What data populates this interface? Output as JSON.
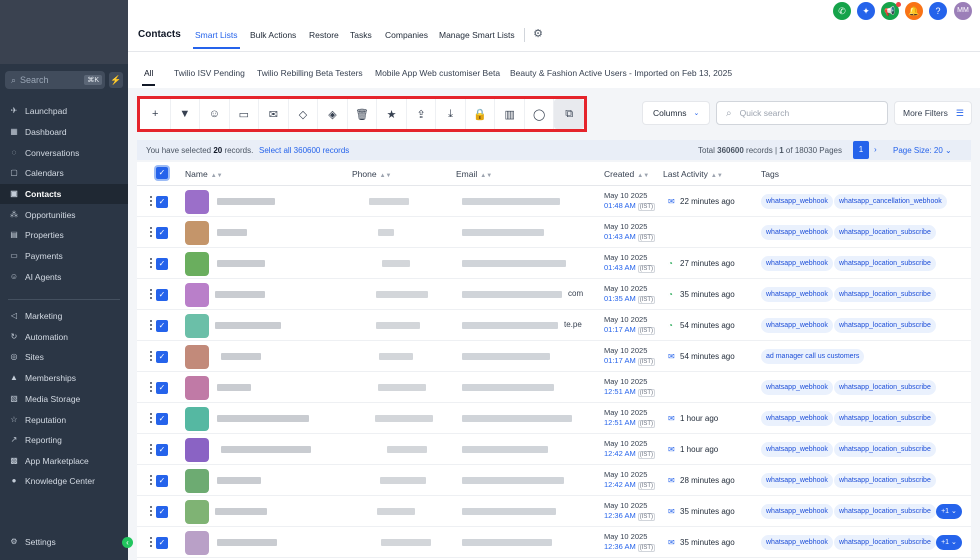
{
  "sidebar": {
    "search_placeholder": "Search",
    "search_shortcut": "⌘K",
    "items": [
      {
        "label": "Launchpad",
        "icon": "rocket-icon"
      },
      {
        "label": "Dashboard",
        "icon": "grid-icon"
      },
      {
        "label": "Conversations",
        "icon": "chat-icon"
      },
      {
        "label": "Calendars",
        "icon": "calendar-icon"
      },
      {
        "label": "Contacts",
        "icon": "person-icon"
      },
      {
        "label": "Opportunities",
        "icon": "nodes-icon"
      },
      {
        "label": "Properties",
        "icon": "building-icon"
      },
      {
        "label": "Payments",
        "icon": "card-icon"
      },
      {
        "label": "AI Agents",
        "icon": "robot-icon"
      },
      {
        "label": "Marketing",
        "icon": "megaphone-icon"
      },
      {
        "label": "Automation",
        "icon": "refresh-icon"
      },
      {
        "label": "Sites",
        "icon": "globe-icon"
      },
      {
        "label": "Memberships",
        "icon": "graduation-icon"
      },
      {
        "label": "Media Storage",
        "icon": "media-icon"
      },
      {
        "label": "Reputation",
        "icon": "star-icon"
      },
      {
        "label": "Reporting",
        "icon": "chart-icon"
      },
      {
        "label": "App Marketplace",
        "icon": "apps-icon"
      },
      {
        "label": "Knowledge Center",
        "icon": "info-icon"
      },
      {
        "label": "Settings",
        "icon": "gear-icon"
      }
    ]
  },
  "header": {
    "title": "Contacts",
    "tabs": [
      "Smart Lists",
      "Bulk Actions",
      "Restore",
      "Tasks",
      "Companies",
      "Manage Smart Lists"
    ],
    "avatar_initials": "MM"
  },
  "smart_lists": [
    "All",
    "Twilio ISV Pending",
    "Twilio Rebilling Beta Testers",
    "Mobile App Web customiser Beta",
    "Beauty & Fashion Active Users - Imported on Feb 13, 2025"
  ],
  "toolbar": {
    "icons": [
      "add-icon",
      "filter-icon",
      "robot-icon",
      "message-icon",
      "email-icon",
      "tag-add-icon",
      "tag-remove-icon",
      "trash-icon",
      "star-icon",
      "upload-icon",
      "download-icon",
      "lock-icon",
      "building-icon",
      "whatsapp-icon",
      "copy-icon"
    ],
    "columns_label": "Columns",
    "search_placeholder": "Quick search",
    "more_filters_label": "More Filters"
  },
  "selection": {
    "prefix": "You have selected ",
    "count": "20",
    "suffix": " records.",
    "select_all": "Select all 360600 records",
    "total_prefix": "Total ",
    "total": "360600",
    "total_mid": " records | ",
    "page": "1",
    "page_suffix": " of 18030 Pages",
    "page_button": "1",
    "page_size": "Page Size: 20"
  },
  "table": {
    "columns": [
      "Name",
      "Phone",
      "Email",
      "Created",
      "Last Activity",
      "Tags"
    ],
    "rows": [
      {
        "date": "May 10 2025",
        "time": "01:48 AM",
        "tz": "(IST)",
        "activity": "22 minutes ago",
        "activity_icon": "email-icon",
        "tags": [
          "whatsapp_webhook",
          "whatsapp_cancellation_webhook"
        ],
        "more": "",
        "email_suffix": ""
      },
      {
        "date": "May 10 2025",
        "time": "01:43 AM",
        "tz": "(IST)",
        "activity": "",
        "activity_icon": "",
        "tags": [
          "whatsapp_webhook",
          "whatsapp_location_subscribe"
        ],
        "more": "",
        "email_suffix": ""
      },
      {
        "date": "May 10 2025",
        "time": "01:43 AM",
        "tz": "(IST)",
        "activity": "27 minutes ago",
        "activity_icon": "whatsapp-icon",
        "tags": [
          "whatsapp_webhook",
          "whatsapp_location_subscribe"
        ],
        "more": "",
        "email_suffix": ""
      },
      {
        "date": "May 10 2025",
        "time": "01:35 AM",
        "tz": "(IST)",
        "activity": "35 minutes ago",
        "activity_icon": "whatsapp-icon",
        "tags": [
          "whatsapp_webhook",
          "whatsapp_location_subscribe"
        ],
        "more": "",
        "email_suffix": "com"
      },
      {
        "date": "May 10 2025",
        "time": "01:17 AM",
        "tz": "(IST)",
        "activity": "54 minutes ago",
        "activity_icon": "whatsapp-icon",
        "tags": [
          "whatsapp_webhook",
          "whatsapp_location_subscribe"
        ],
        "more": "",
        "email_suffix": "te.pe"
      },
      {
        "date": "May 10 2025",
        "time": "01:17 AM",
        "tz": "(IST)",
        "activity": "54 minutes ago",
        "activity_icon": "email-icon",
        "tags": [
          "ad manager call us customers"
        ],
        "more": "",
        "email_suffix": ""
      },
      {
        "date": "May 10 2025",
        "time": "12:51 AM",
        "tz": "(IST)",
        "activity": "",
        "activity_icon": "",
        "tags": [
          "whatsapp_webhook",
          "whatsapp_location_subscribe"
        ],
        "more": "",
        "email_suffix": ""
      },
      {
        "date": "May 10 2025",
        "time": "12:51 AM",
        "tz": "(IST)",
        "activity": "1 hour ago",
        "activity_icon": "email-icon",
        "tags": [
          "whatsapp_webhook",
          "whatsapp_location_subscribe"
        ],
        "more": "",
        "email_suffix": ""
      },
      {
        "date": "May 10 2025",
        "time": "12:42 AM",
        "tz": "(IST)",
        "activity": "1 hour ago",
        "activity_icon": "email-icon",
        "tags": [
          "whatsapp_webhook",
          "whatsapp_location_subscribe"
        ],
        "more": "",
        "email_suffix": ""
      },
      {
        "date": "May 10 2025",
        "time": "12:42 AM",
        "tz": "(IST)",
        "activity": "28 minutes ago",
        "activity_icon": "email-icon",
        "tags": [
          "whatsapp_webhook",
          "whatsapp_location_subscribe"
        ],
        "more": "",
        "email_suffix": ""
      },
      {
        "date": "May 10 2025",
        "time": "12:36 AM",
        "tz": "(IST)",
        "activity": "35 minutes ago",
        "activity_icon": "email-icon",
        "tags": [
          "whatsapp_webhook",
          "whatsapp_location_subscribe"
        ],
        "more": "+1",
        "email_suffix": ""
      },
      {
        "date": "May 10 2025",
        "time": "12:36 AM",
        "tz": "(IST)",
        "activity": "35 minutes ago",
        "activity_icon": "email-icon",
        "tags": [
          "whatsapp_webhook",
          "whatsapp_location_subscribe"
        ],
        "more": "+1",
        "email_suffix": ""
      }
    ]
  },
  "colors": {
    "accent": "#2563eb",
    "sidebar_bg": "#2b3645",
    "highlight_border": "#e5242b",
    "avatars": [
      "#9b6fc9",
      "#c4956a",
      "#6aae5e",
      "#b97fc9",
      "#6bbfa8",
      "#c28a7a",
      "#c07aa6",
      "#55b8a2",
      "#8a63c4",
      "#6dab72",
      "#7fb374",
      "#b9a0c7"
    ]
  }
}
